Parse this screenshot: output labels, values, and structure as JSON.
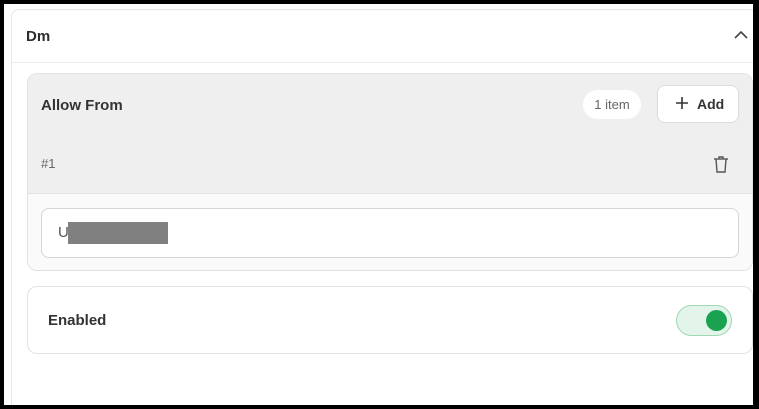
{
  "section": {
    "title": "Dm"
  },
  "allow_from": {
    "title": "Allow From",
    "count_label": "1 item",
    "add_label": "Add",
    "items": [
      {
        "index_label": "#1",
        "value": "U"
      }
    ]
  },
  "enabled": {
    "label": "Enabled",
    "value": true
  },
  "colors": {
    "toggle_on": "#1aa251"
  }
}
